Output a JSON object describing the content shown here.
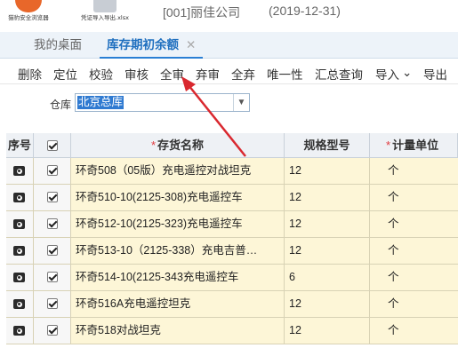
{
  "desktop_icons": [
    {
      "caption": "猫豹安全浏览器",
      "glyph_color": "#e8672a"
    },
    {
      "caption": "凭证导入导出.xlsx",
      "glyph_color": "#c8cdd4"
    }
  ],
  "header": {
    "company": "[001]丽佳公司",
    "year": "(2019-12-31)"
  },
  "tabs": {
    "desk": "我的桌面",
    "active": "库存期初余额",
    "close_glyph": "✕"
  },
  "toolbar": {
    "delete": "删除",
    "locate": "定位",
    "verify": "校验",
    "audit": "审核",
    "audit_all": "全审",
    "unaudit": "弃审",
    "unaudit_all": "全弃",
    "unique": "唯一性",
    "summary_query": "汇总查询",
    "import": "导入",
    "import_chevron": "⌄",
    "export": "导出"
  },
  "filter": {
    "warehouse_label": "仓库",
    "warehouse_value": "北京总库",
    "dropdown_icon": "chevron-down-icon"
  },
  "grid": {
    "columns": {
      "seq": "序号",
      "name_required": "*",
      "name": "存货名称",
      "spec": "规格型号",
      "unit_required": "*",
      "unit": "计量单位"
    },
    "rows": [
      {
        "name": "环奇508（05版）充电遥控对战坦克",
        "spec": "12",
        "unit": "个"
      },
      {
        "name": "环奇510-10(2125-308)充电遥控车",
        "spec": "12",
        "unit": "个"
      },
      {
        "name": "环奇512-10(2125-323)充电遥控车",
        "spec": "12",
        "unit": "个"
      },
      {
        "name": "环奇513-10（2125-338）充电吉普…",
        "spec": "12",
        "unit": "个"
      },
      {
        "name": "环奇514-10(2125-343充电遥控车",
        "spec": "6",
        "unit": "个"
      },
      {
        "name": "环奇516A充电遥控坦克",
        "spec": "12",
        "unit": "个"
      },
      {
        "name": "环奇518对战坦克",
        "spec": "12",
        "unit": "个"
      }
    ]
  },
  "colors": {
    "accent": "#2a7fd4",
    "annotation_arrow": "#d9282f",
    "row_highlight": "#fdf6d7"
  }
}
